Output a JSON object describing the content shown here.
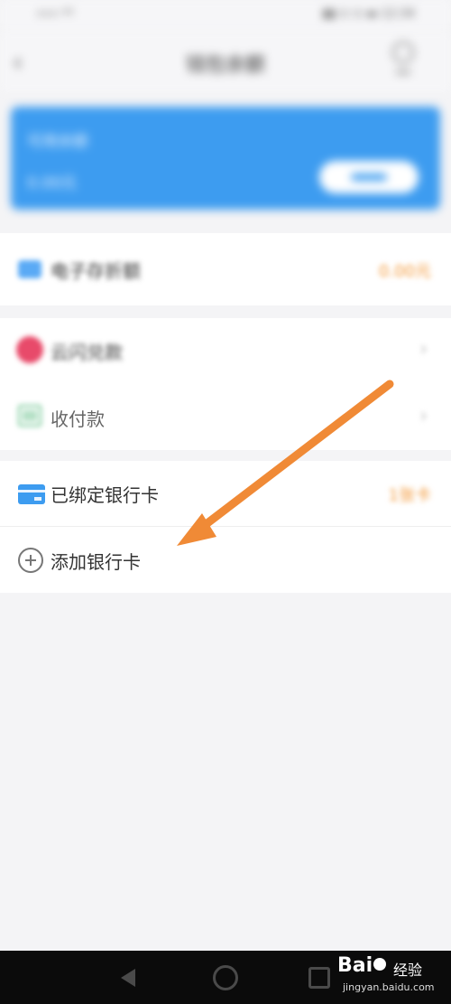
{
  "status_bar": {
    "left_text": "••• ⁴ᴳ",
    "right_text": "▮▮ ⊙ ⊙ ▬ 12:34"
  },
  "header": {
    "title": "钱包余额"
  },
  "balance_card": {
    "label": "可用余额",
    "amount": "0.00元"
  },
  "sections": {
    "ewallet": {
      "label": "电子存折额",
      "right": "0.00元"
    },
    "red_item": {
      "label": "云闪兑款"
    },
    "pay": {
      "label": "收付款"
    },
    "bound_cards": {
      "label": "已绑定银行卡",
      "right": "1张卡"
    },
    "add_card": {
      "label": "添加银行卡"
    }
  },
  "watermark": {
    "brand": "Bai",
    "cn": "经验",
    "url": "jingyan.baidu.com"
  },
  "colors": {
    "accent_blue": "#3d9cf0",
    "orange": "#f39a3c",
    "annotation_arrow": "#f08a36"
  }
}
